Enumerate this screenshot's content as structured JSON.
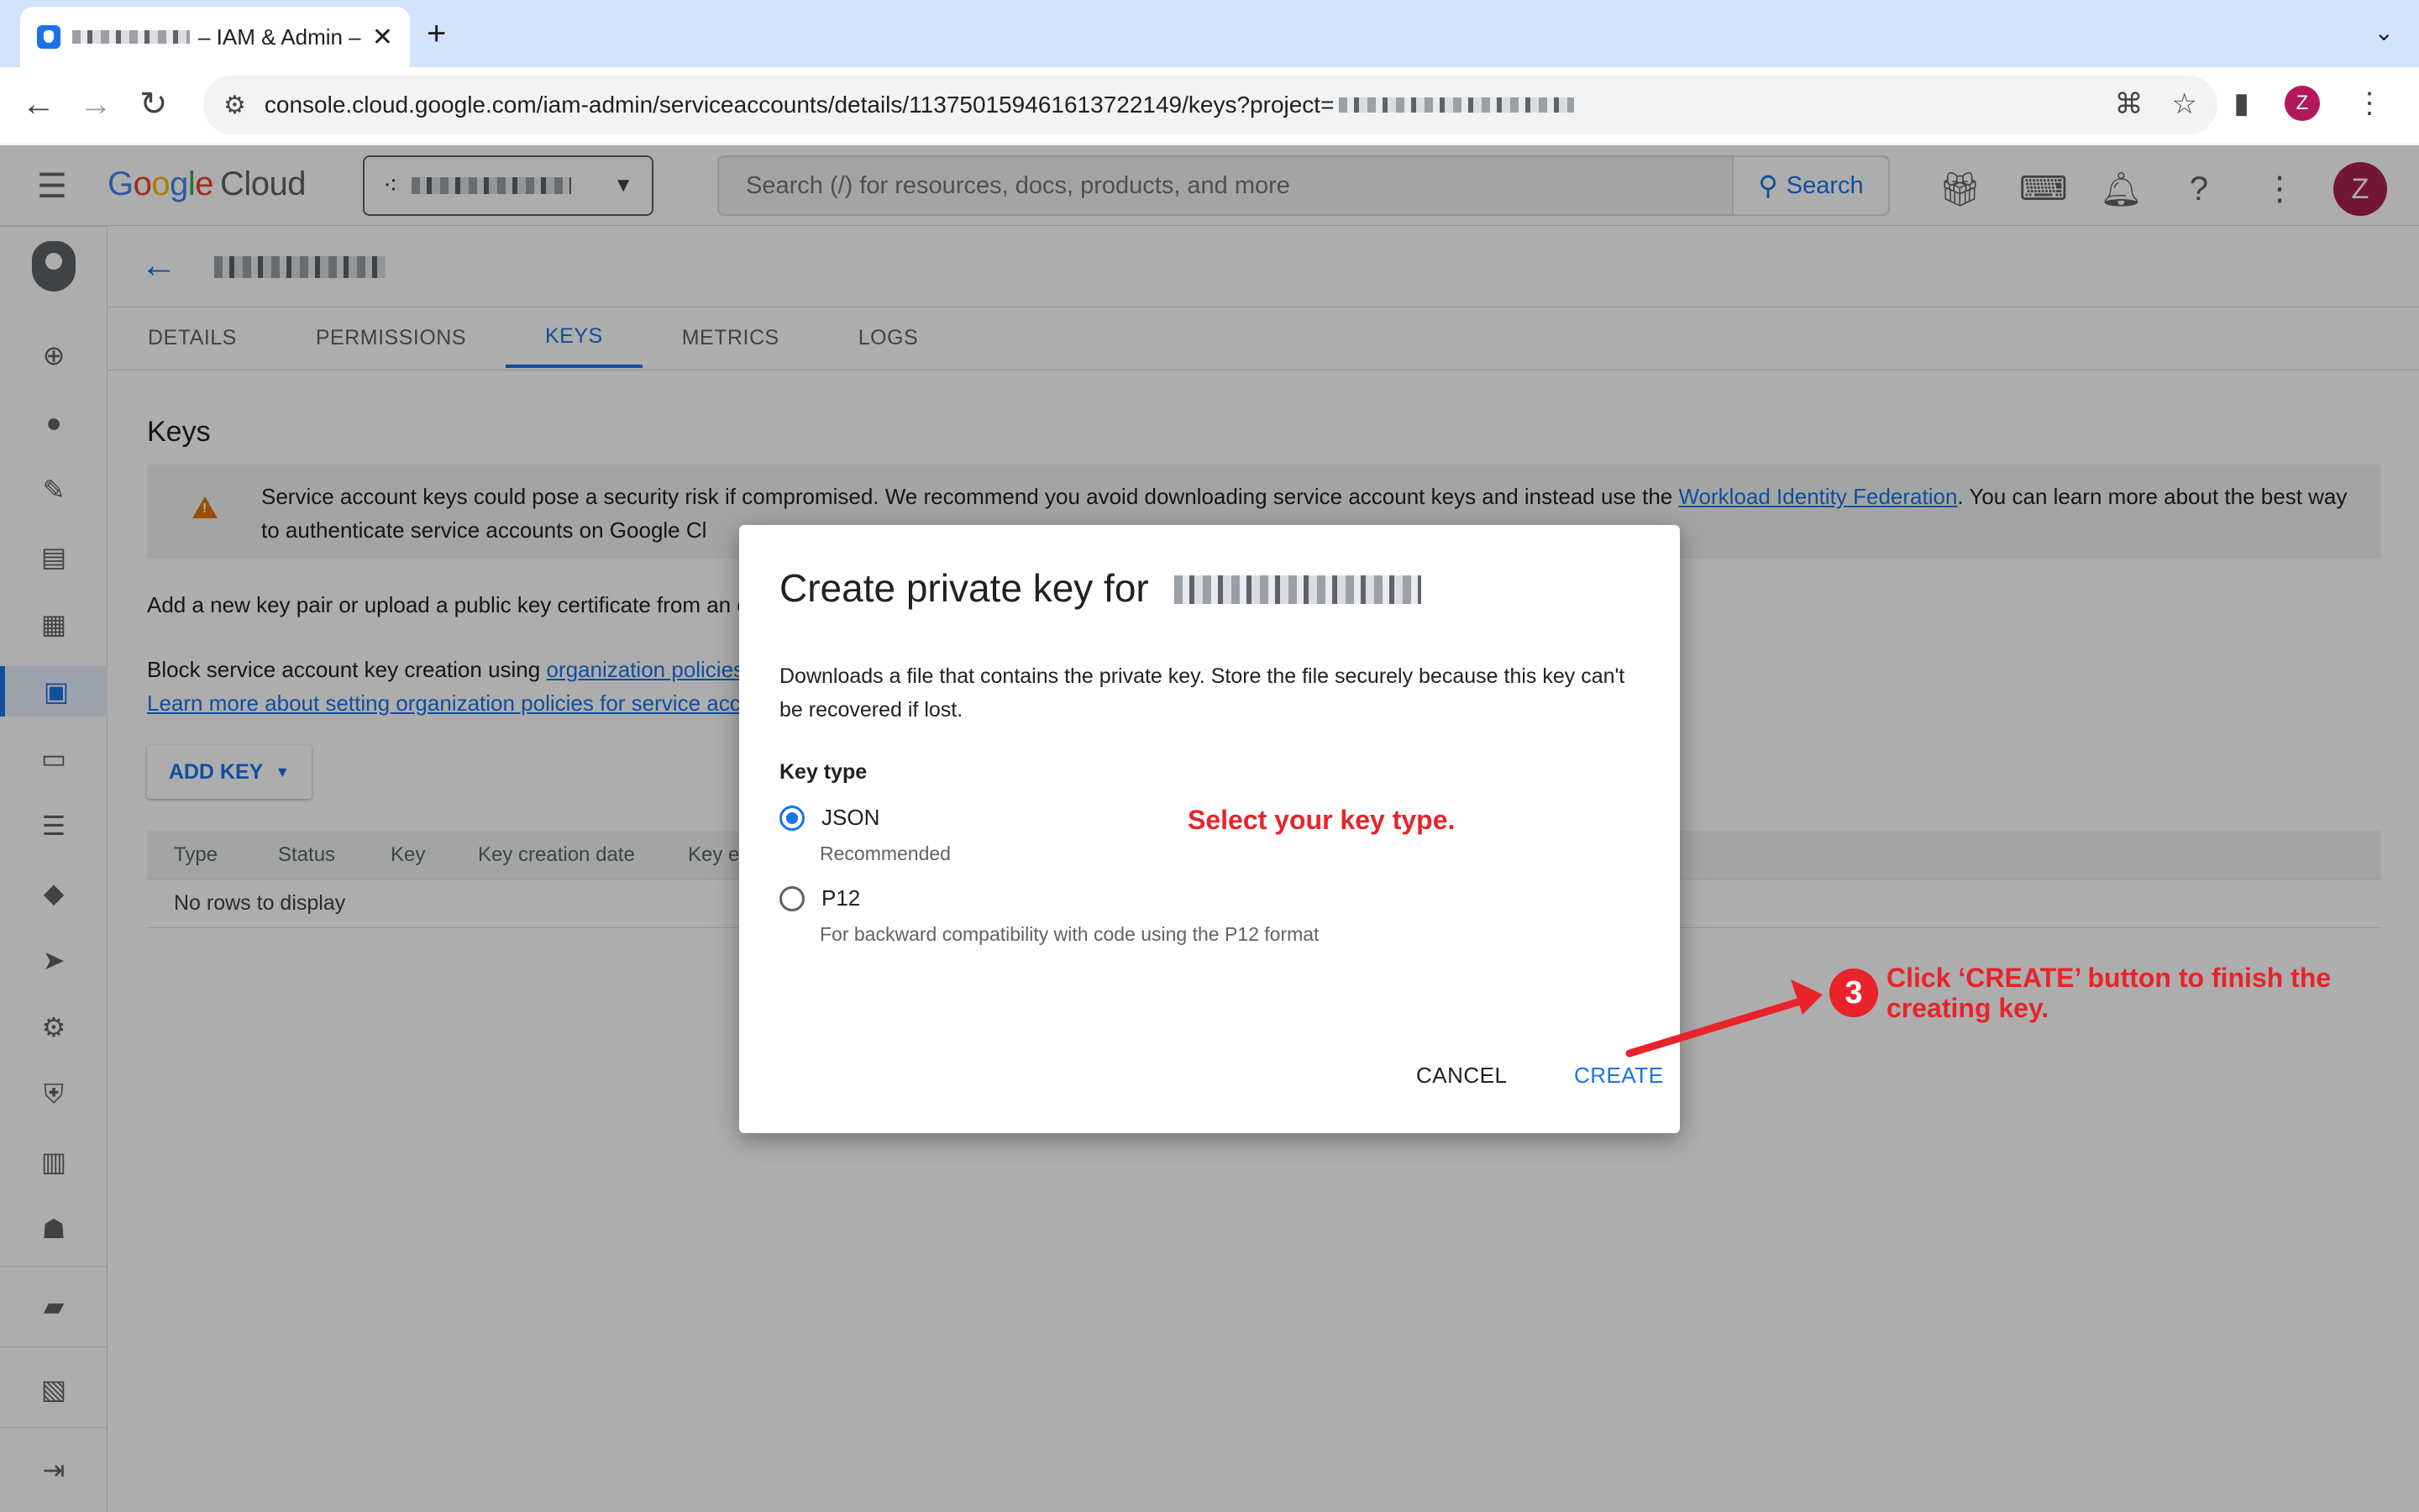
{
  "browser": {
    "tab_title": "– IAM & Admin –",
    "url": "console.cloud.google.com/iam-admin/serviceaccounts/details/113750159461613722149/keys?project=",
    "profile_initial": "Z",
    "icons": [
      "back-icon",
      "forward-icon",
      "reload-icon",
      "site-info-icon",
      "translate-icon",
      "bookmark-star-icon",
      "side-panel-icon",
      "kebab-menu-icon"
    ]
  },
  "header": {
    "logo_google": [
      "G",
      "o",
      "o",
      "g",
      "l",
      "e"
    ],
    "logo_cloud": "Cloud",
    "search_placeholder": "Search (/) for resources, docs, products, and more",
    "search_button": "Search",
    "avatar_initial": "Z",
    "icons": [
      "gift-icon",
      "cloud-shell-icon",
      "notifications-icon",
      "help-icon",
      "more-vert-icon"
    ]
  },
  "rail": {
    "icons": [
      "iam-shield-icon",
      "person-add-icon",
      "account-circle-icon",
      "build-icon",
      "policy-doc-icon",
      "article-icon",
      "service-accounts-icon",
      "badge-icon",
      "list-icon",
      "label-icon",
      "tag-icon",
      "settings-icon",
      "security-icon",
      "table-icon",
      "groups-icon",
      "folder-settings-icon",
      "release-notes-icon",
      "expand-icon"
    ]
  },
  "page": {
    "tabs": [
      {
        "label": "DETAILS"
      },
      {
        "label": "PERMISSIONS"
      },
      {
        "label": "KEYS"
      },
      {
        "label": "METRICS"
      },
      {
        "label": "LOGS"
      }
    ],
    "active_tab": "KEYS",
    "heading": "Keys",
    "warning_text_1": "Service account keys could pose a security risk if compromised. We recommend you avoid downloading service account keys and instead use the ",
    "warning_link_1": "Workload Identity Federation",
    "warning_text_2": ". You can learn more about the best way to authenticate service accounts on Google Cl",
    "add_text": "Add a new key pair or upload a public key certificate from an e",
    "block_text": "Block service account key creation using ",
    "block_link": "organization policies",
    "learn_link": "Learn more about setting organization policies for service acc",
    "add_key_button": "ADD KEY",
    "table": {
      "columns": [
        "Type",
        "Status",
        "Key",
        "Key creation date",
        "Key ex"
      ],
      "empty_text": "No rows to display"
    }
  },
  "dialog": {
    "title": "Create private key for",
    "description": "Downloads a file that contains the private key. Store the file securely because this key can't be recovered if lost.",
    "key_type_label": "Key type",
    "options": [
      {
        "label": "JSON",
        "sublabel": "Recommended",
        "checked": true
      },
      {
        "label": "P12",
        "sublabel": "For backward compatibility with code using the P12 format",
        "checked": false
      }
    ],
    "cancel_button": "CANCEL",
    "create_button": "CREATE"
  },
  "annotations": {
    "select_hint": "Select your key type.",
    "step_number": "3",
    "step_text": "Click ‘CREATE’ button to finish the creating key.",
    "color": "#e8232a"
  }
}
